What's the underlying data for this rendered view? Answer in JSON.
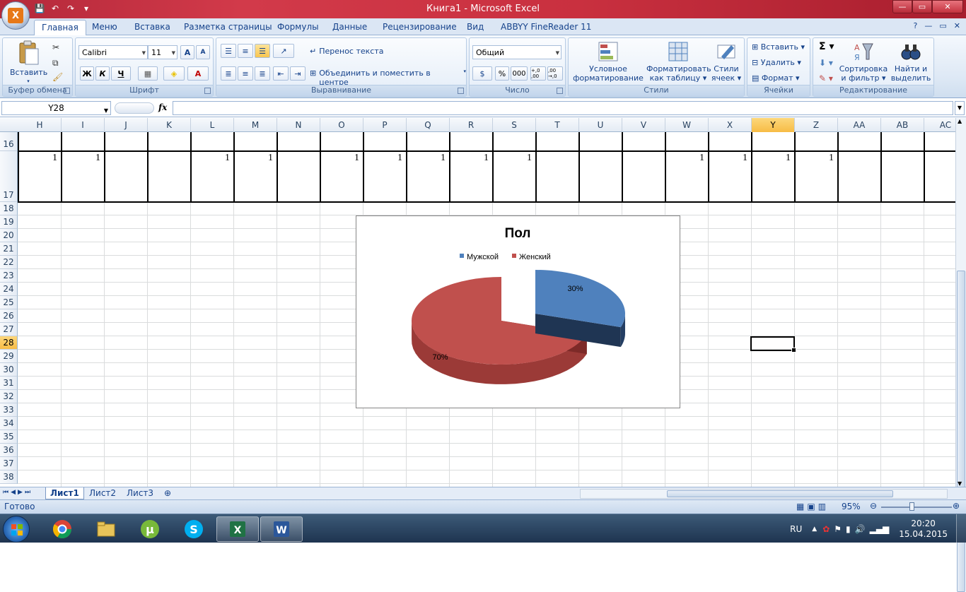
{
  "window": {
    "title": "Книга1 - Microsoft Excel",
    "app_logo": "X",
    "controls": {
      "min": "—",
      "max": "▭",
      "close": "✕"
    }
  },
  "ribbon_tabs": [
    "Главная",
    "Меню",
    "Вставка",
    "Разметка страницы",
    "Формулы",
    "Данные",
    "Рецензирование",
    "Вид",
    "ABBYY FineReader 11"
  ],
  "ribbon": {
    "clipboard": {
      "label": "Буфер обмена",
      "paste": "Вставить"
    },
    "font": {
      "label": "Шрифт",
      "name": "Calibri",
      "size": "11",
      "bold": "Ж",
      "italic": "К",
      "underline": "Ч",
      "grow": "A",
      "shrink": "A"
    },
    "alignment": {
      "label": "Выравнивание",
      "wrap": "Перенос текста",
      "merge": "Объединить и поместить в центре"
    },
    "number": {
      "label": "Число",
      "format": "Общий",
      "percent": "%",
      "thousands": "000",
      "inc_dec": "+,0 ,00",
      "dec_dec": ",00 →,0"
    },
    "styles": {
      "label": "Стили",
      "conditional_1": "Условное",
      "conditional_2": "форматирование",
      "table_1": "Форматировать",
      "table_2": "как таблицу",
      "cell_1": "Стили",
      "cell_2": "ячеек"
    },
    "cells": {
      "label": "Ячейки",
      "insert": "Вставить",
      "delete": "Удалить",
      "format": "Формат"
    },
    "editing": {
      "label": "Редактирование",
      "sort_1": "Сортировка",
      "sort_2": "и фильтр",
      "find_1": "Найти и",
      "find_2": "выделить"
    }
  },
  "formula_bar": {
    "name_box": "Y28",
    "fx": "fx",
    "value": ""
  },
  "columns": [
    "H",
    "I",
    "J",
    "K",
    "L",
    "M",
    "N",
    "O",
    "P",
    "Q",
    "R",
    "S",
    "T",
    "U",
    "V",
    "W",
    "X",
    "Y",
    "Z",
    "AA",
    "AB",
    "AC"
  ],
  "selected_column": "Y",
  "rows": [
    "16",
    "17",
    "18",
    "19",
    "20",
    "21",
    "22",
    "23",
    "24",
    "25",
    "26",
    "27",
    "28",
    "29",
    "30",
    "31",
    "32",
    "33",
    "34",
    "35",
    "36",
    "37",
    "38"
  ],
  "selected_row": "28",
  "row17_values": [
    "1",
    "1",
    "",
    "",
    "1",
    "1",
    "",
    "1",
    "1",
    "1",
    "1",
    "1",
    "",
    "",
    "",
    "1",
    "1",
    "1",
    "1",
    "",
    "",
    ""
  ],
  "chart_data": {
    "type": "pie",
    "title": "Пол",
    "categories": [
      "Мужской",
      "Женский"
    ],
    "values": [
      30,
      70
    ],
    "data_labels": [
      "30%",
      "70%"
    ],
    "colors": [
      "#4f81bd",
      "#c0504d"
    ],
    "legend": "top",
    "style": "3d-exploded"
  },
  "sheets": [
    "Лист1",
    "Лист2",
    "Лист3"
  ],
  "active_sheet": "Лист1",
  "status": {
    "ready": "Готово",
    "zoom": "95%"
  },
  "tray": {
    "lang": "RU",
    "time": "20:20",
    "date": "15.04.2015"
  }
}
